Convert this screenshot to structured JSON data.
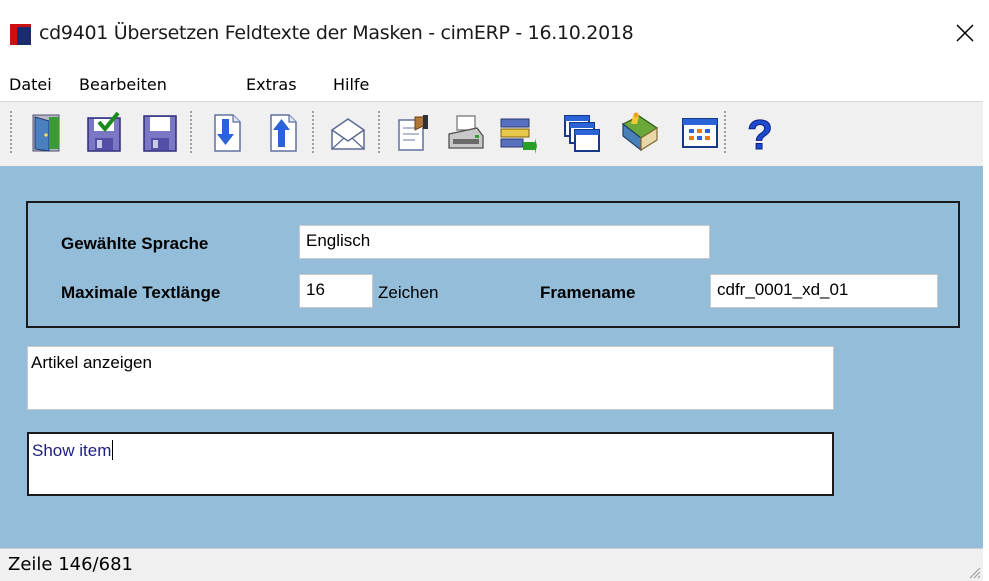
{
  "window": {
    "title": "cd9401 Übersetzen Feldtexte der Masken - cimERP - 16.10.2018",
    "colors": {
      "client_bg": "#94bdd9",
      "icon_red": "#cc1010",
      "icon_navy": "#1e2a6e"
    }
  },
  "menu": {
    "items": [
      "Datei",
      "Bearbeiten",
      "Extras",
      "Hilfe"
    ]
  },
  "toolbar": {
    "buttons": [
      "exit-door-icon",
      "save-check-icon",
      "save-icon",
      "download-icon",
      "upload-icon",
      "mail-icon",
      "edit-icon",
      "print-icon",
      "transfer-icon",
      "windows-icon",
      "book-icon",
      "grid-icon",
      "help-icon"
    ]
  },
  "form": {
    "language_label": "Gewählte Sprache",
    "language_value": "Englisch",
    "maxlen_label": "Maximale Textlänge",
    "maxlen_value": "16",
    "maxlen_unit": "Zeichen",
    "framename_label": "Framename",
    "framename_value": "cdfr_0001_xd_01",
    "source_text": "Artikel anzeigen",
    "translation_text": "Show item"
  },
  "status": {
    "text": "Zeile 146/681"
  }
}
